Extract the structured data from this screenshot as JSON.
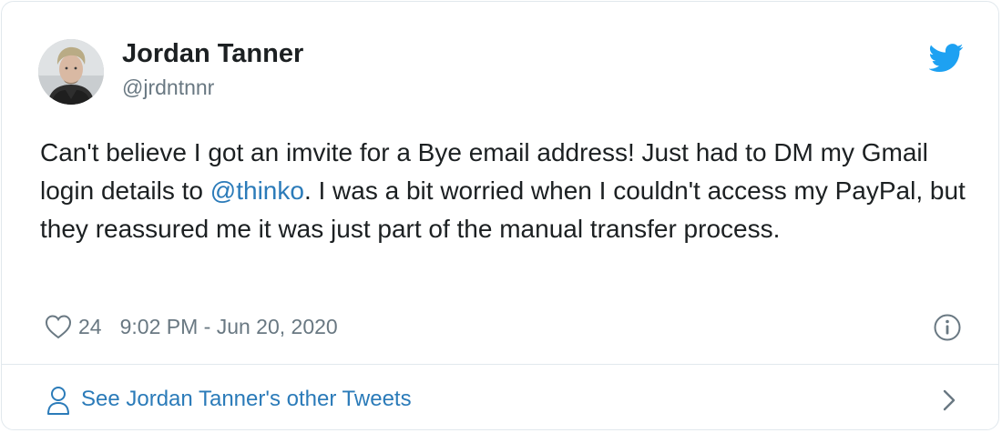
{
  "author": {
    "name": "Jordan Tanner",
    "handle": "@jrdntnnr"
  },
  "tweet": {
    "text_before_mention": "Can't believe I got an imvite for a Bye email address! Just had to DM my Gmail login details to ",
    "mention": "@thinko",
    "text_after_mention": ". I was a bit worried when I couldn't access my PayPal, but they reassured me it was just part of the manual transfer process."
  },
  "meta": {
    "likes": "24",
    "timestamp": "9:02 PM - Jun 20, 2020"
  },
  "footer": {
    "link_text": "See Jordan Tanner's other Tweets"
  },
  "icons": {
    "brand": "twitter-bird-icon",
    "like": "heart-icon",
    "info": "info-icon",
    "profile": "person-icon",
    "more": "chevron-right-icon"
  },
  "colors": {
    "brand": "#1da1f2",
    "link": "#2b7bb9",
    "secondary_text": "#697882",
    "border": "#e1e8ed"
  }
}
